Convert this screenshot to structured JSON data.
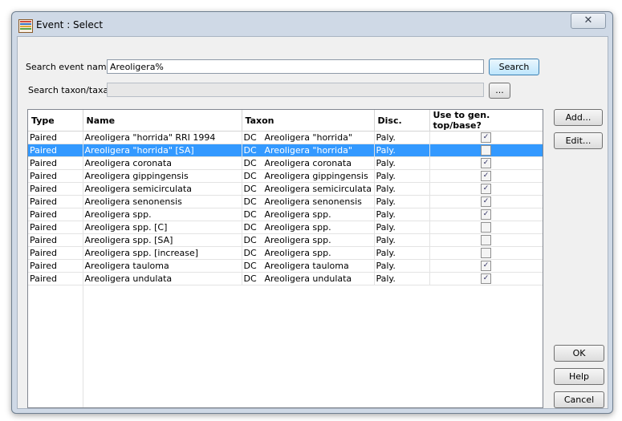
{
  "window": {
    "title": "Event : Select",
    "close_glyph": "✕"
  },
  "search": {
    "event_label": "Search event name:",
    "event_value": "Areoligera%",
    "search_button": "Search",
    "taxon_label": "Search taxon/taxa:",
    "taxon_value": "",
    "browse_button": "..."
  },
  "table": {
    "columns": [
      "Type",
      "Name",
      "Taxon",
      "Disc.",
      "Use to gen. top/base?"
    ],
    "selected_row": 1,
    "rows": [
      {
        "type": "Paired",
        "name": "Areoligera \"horrida\"  RRI 1994",
        "taxon_code": "DC",
        "taxon": "Areoligera \"horrida\"",
        "disc": "Paly.",
        "use": true
      },
      {
        "type": "Paired",
        "name": "Areoligera \"horrida\" [SA]",
        "taxon_code": "DC",
        "taxon": "Areoligera \"horrida\"",
        "disc": "Paly.",
        "use": false
      },
      {
        "type": "Paired",
        "name": "Areoligera coronata",
        "taxon_code": "DC",
        "taxon": "Areoligera coronata",
        "disc": "Paly.",
        "use": true
      },
      {
        "type": "Paired",
        "name": "Areoligera gippingensis",
        "taxon_code": "DC",
        "taxon": "Areoligera gippingensis",
        "disc": "Paly.",
        "use": true
      },
      {
        "type": "Paired",
        "name": "Areoligera semicirculata",
        "taxon_code": "DC",
        "taxon": "Areoligera semicirculata",
        "disc": "Paly.",
        "use": true
      },
      {
        "type": "Paired",
        "name": "Areoligera senonensis",
        "taxon_code": "DC",
        "taxon": "Areoligera senonensis",
        "disc": "Paly.",
        "use": true
      },
      {
        "type": "Paired",
        "name": "Areoligera spp.",
        "taxon_code": "DC",
        "taxon": "Areoligera spp.",
        "disc": "Paly.",
        "use": true
      },
      {
        "type": "Paired",
        "name": "Areoligera spp. [C]",
        "taxon_code": "DC",
        "taxon": "Areoligera spp.",
        "disc": "Paly.",
        "use": false
      },
      {
        "type": "Paired",
        "name": "Areoligera spp. [SA]",
        "taxon_code": "DC",
        "taxon": "Areoligera spp.",
        "disc": "Paly.",
        "use": false
      },
      {
        "type": "Paired",
        "name": "Areoligera spp. [increase]",
        "taxon_code": "DC",
        "taxon": "Areoligera spp.",
        "disc": "Paly.",
        "use": false
      },
      {
        "type": "Paired",
        "name": "Areoligera tauloma",
        "taxon_code": "DC",
        "taxon": "Areoligera tauloma",
        "disc": "Paly.",
        "use": true
      },
      {
        "type": "Paired",
        "name": "Areoligera undulata",
        "taxon_code": "DC",
        "taxon": "Areoligera undulata",
        "disc": "Paly.",
        "use": true
      }
    ]
  },
  "side_buttons": {
    "add": "Add...",
    "edit": "Edit..."
  },
  "footer_buttons": {
    "ok": "OK",
    "help": "Help",
    "cancel": "Cancel"
  },
  "colors": {
    "selection": "#3399ff",
    "frame": "#cfd9e6"
  }
}
